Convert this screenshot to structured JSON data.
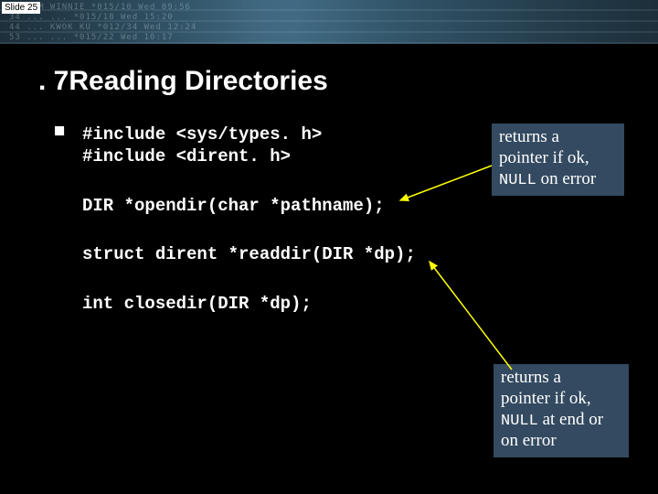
{
  "slide_label": "Slide 25",
  "title": ". 7Reading Directories",
  "code": {
    "include1": "#include <sys/types. h>",
    "include2": "#include <dirent. h>",
    "opendir": "DIR *opendir(char *pathname);",
    "readdir": "struct dirent *readdir(DIR *dp);",
    "closedir": "int closedir(DIR *dp);"
  },
  "note1": {
    "line1": "returns a",
    "line2": "pointer if ok,",
    "null_word": "NULL",
    "line3_rest": " on error"
  },
  "note2": {
    "line1": "returns a",
    "line2": "pointer if ok,",
    "null_word": "NULL",
    "line3_rest": " at end or",
    "line4": "on error"
  },
  "colors": {
    "note_bg": "#334A60",
    "arrow": "#FFFF00"
  }
}
